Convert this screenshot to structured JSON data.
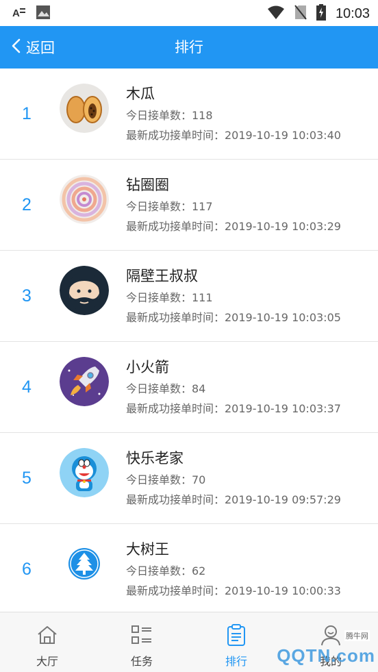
{
  "status_bar": {
    "time": "10:03",
    "icons": [
      "font-a-icon",
      "photo-icon",
      "wifi-icon",
      "no-sim-icon",
      "battery-charging-icon"
    ]
  },
  "header": {
    "back_label": "返回",
    "title": "排行",
    "accent": "#2196f3"
  },
  "rankings": [
    {
      "rank": "1",
      "name": "木瓜",
      "orders": "今日接单数：118",
      "last_time": "最新成功接单时间：2019-10-19 10:03:40",
      "avatar": "papaya-avatar"
    },
    {
      "rank": "2",
      "name": "钻圈圈",
      "orders": "今日接单数：117",
      "last_time": "最新成功接单时间：2019-10-19 10:03:29",
      "avatar": "swirl-avatar"
    },
    {
      "rank": "3",
      "name": "隔壁王叔叔",
      "orders": "今日接单数：111",
      "last_time": "最新成功接单时间：2019-10-19 10:03:05",
      "avatar": "bearded-man-avatar"
    },
    {
      "rank": "4",
      "name": "小火箭",
      "orders": "今日接单数：84",
      "last_time": "最新成功接单时间：2019-10-19 10:03:37",
      "avatar": "rocket-avatar"
    },
    {
      "rank": "5",
      "name": "快乐老家",
      "orders": "今日接单数：70",
      "last_time": "最新成功接单时间：2019-10-19 09:57:29",
      "avatar": "doraemon-avatar"
    },
    {
      "rank": "6",
      "name": "大树王",
      "orders": "今日接单数：62",
      "last_time": "最新成功接单时间：2019-10-19 10:00:33",
      "avatar": "tree-avatar"
    }
  ],
  "tabs": [
    {
      "label": "大厅",
      "icon": "home-icon",
      "active": false
    },
    {
      "label": "任务",
      "icon": "task-list-icon",
      "active": false
    },
    {
      "label": "排行",
      "icon": "clipboard-icon",
      "active": true
    },
    {
      "label": "我的",
      "icon": "user-icon",
      "active": false
    }
  ],
  "watermark": {
    "text": "QQTN.com",
    "small": "腾牛网"
  }
}
